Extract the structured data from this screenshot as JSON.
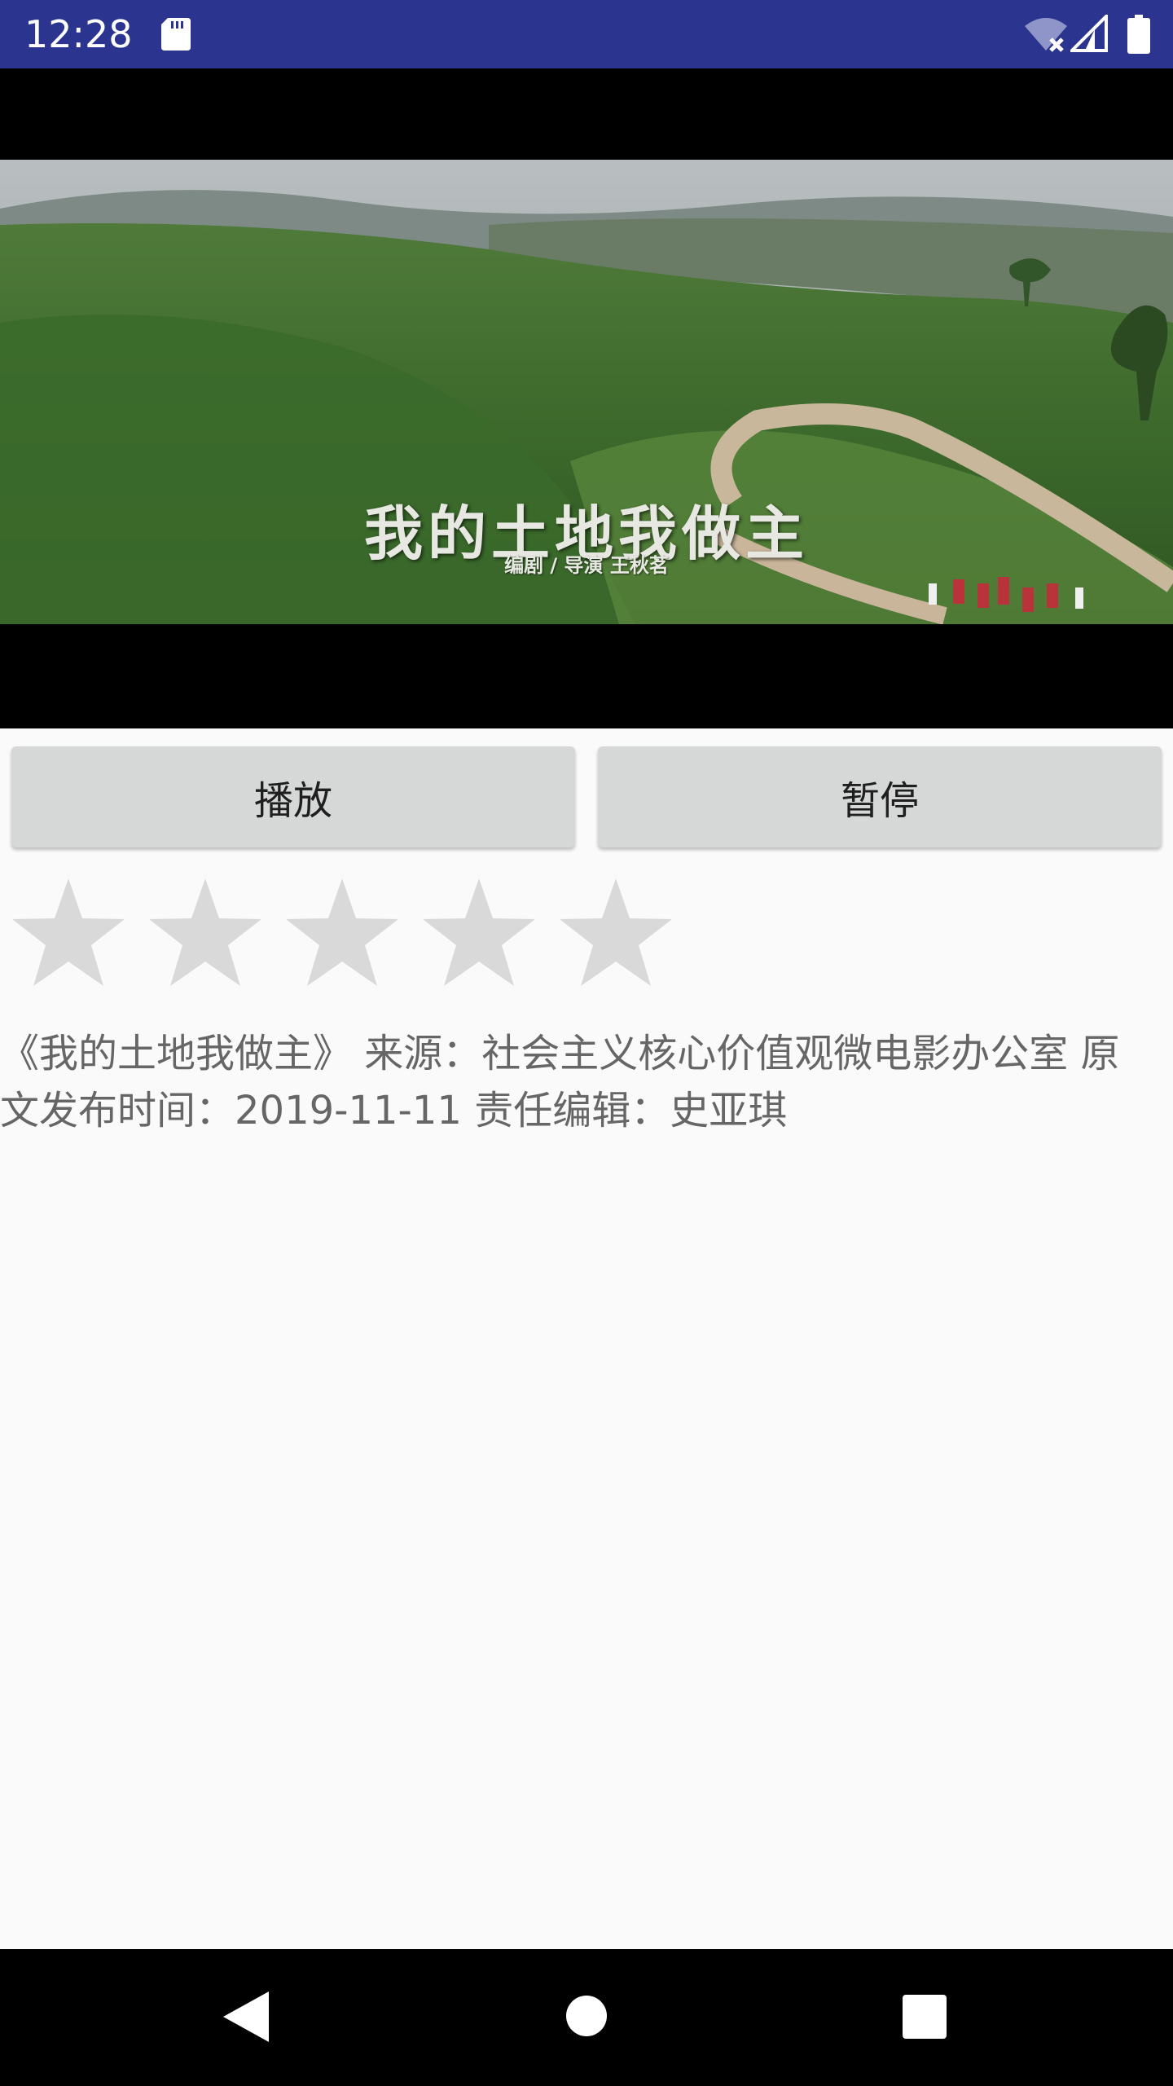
{
  "status_bar": {
    "time": "12:28",
    "icons": [
      "sd-card-icon",
      "wifi-off-icon",
      "signal-icon",
      "battery-icon"
    ],
    "background": "#2b3590"
  },
  "video": {
    "title": "我的土地我做主",
    "credit": "编剧 / 导演  王秋茗"
  },
  "controls": {
    "play_label": "播放",
    "pause_label": "暂停"
  },
  "rating": {
    "max": 5,
    "value": 0,
    "star_color": "#d9d9d9"
  },
  "info": {
    "text": "《我的土地我做主》 来源：社会主义核心价值观微电影办公室 原文发布时间：2019-11-11 责任编辑：史亚琪"
  },
  "nav_bar": {
    "icons": [
      "back-icon",
      "home-icon",
      "recents-icon"
    ]
  }
}
